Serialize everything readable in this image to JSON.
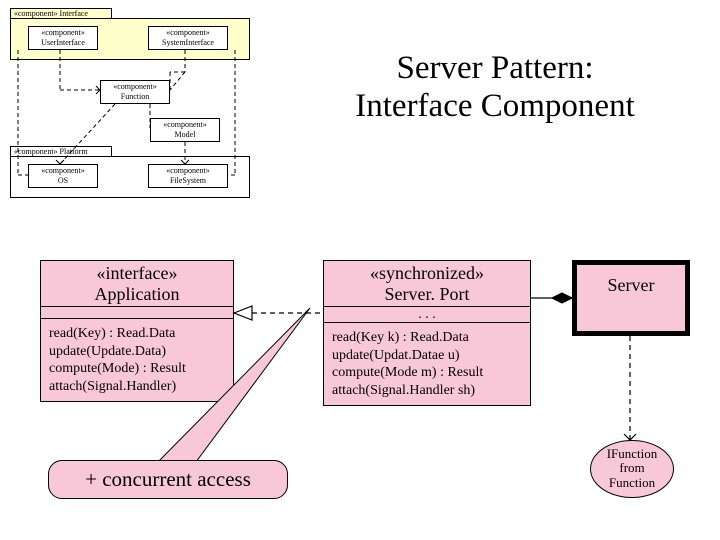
{
  "title_line1": "Server Pattern:",
  "title_line2": "Interface Component",
  "topLeft": {
    "interfacePkg": "«component» Interface",
    "userInterface_stereo": "«component»",
    "userInterface_name": "UserInterface",
    "systemInterface_stereo": "«component»",
    "systemInterface_name": "SystemInterface",
    "function_stereo": "«component»",
    "function_name": "Function",
    "model_stereo": "«component»",
    "model_name": "Model",
    "platformPkg": "«component» Platform",
    "os_stereo": "«component»",
    "os_name": "OS",
    "filesystem_stereo": "«component»",
    "filesystem_name": "FileSystem"
  },
  "interfaceClass": {
    "head_stereo": "«interface»",
    "head_name": "Application",
    "ops": "read(Key) : Read.Data\nupdate(Update.Data)\ncompute(Mode) : Result\nattach(Signal.Handler)"
  },
  "serverPort": {
    "head_stereo": "«synchronized»",
    "head_name": "Server. Port",
    "dots": ". . .",
    "ops": "read(Key k) : Read.Data\nupdate(Updat.Datae u)\ncompute(Mode m) : Result\nattach(Signal.Handler sh)"
  },
  "server_label": "Server",
  "callout_text": "+  concurrent access",
  "ifunction_l1": "IFunction",
  "ifunction_l2": "from",
  "ifunction_l3": "Function"
}
